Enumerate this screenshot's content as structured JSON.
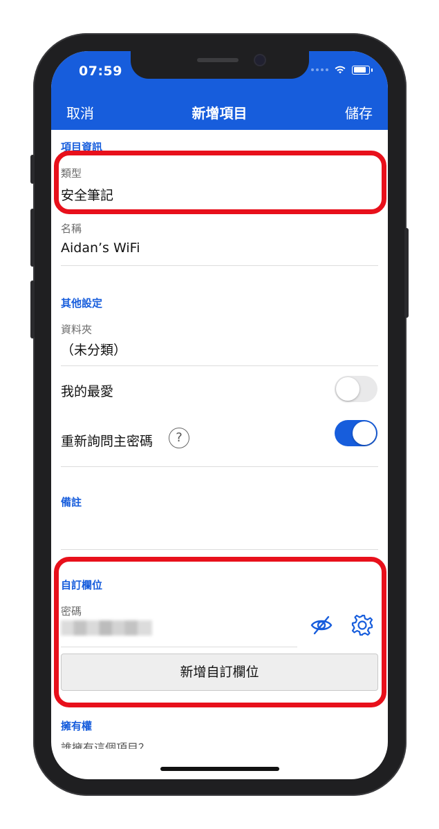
{
  "status_bar": {
    "time": "07:59"
  },
  "nav": {
    "cancel": "取消",
    "title": "新增項目",
    "save": "儲存"
  },
  "item_info": {
    "header": "項目資訊",
    "type_label": "類型",
    "type_value": "安全筆記",
    "name_label": "名稱",
    "name_value": "Aidan’s WiFi"
  },
  "other_settings": {
    "header": "其他設定",
    "folder_label": "資料夾",
    "folder_value": "（未分類）",
    "favorite_label": "我的最愛",
    "favorite_on": false,
    "reprompt_label": "重新詢問主密碼",
    "reprompt_on": true
  },
  "notes": {
    "header": "備註"
  },
  "custom_fields": {
    "header": "自訂欄位",
    "field_label": "密碼",
    "add_button": "新增自訂欄位"
  },
  "ownership": {
    "header": "擁有權",
    "partial_text": "誰擁有這個項目？"
  },
  "colors": {
    "brand_blue": "#175ddc",
    "highlight_red": "#e8101b"
  }
}
